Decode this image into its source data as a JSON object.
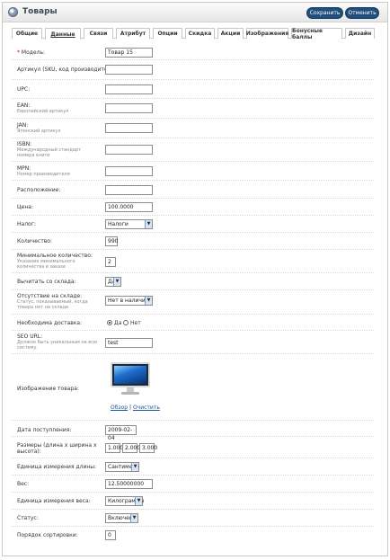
{
  "header": {
    "title": "Товары",
    "save_label": "Сохранить",
    "cancel_label": "Отменить"
  },
  "tabs": [
    {
      "label": "Общие"
    },
    {
      "label": "Данные"
    },
    {
      "label": "Связи"
    },
    {
      "label": "Атрибут"
    },
    {
      "label": "Опции"
    },
    {
      "label": "Скидка"
    },
    {
      "label": "Акции"
    },
    {
      "label": "Изображения"
    },
    {
      "label": "Бонусные баллы"
    },
    {
      "label": "Дизайн"
    }
  ],
  "active_tab": "Данные",
  "form": {
    "model": {
      "required_mark": "*",
      "label": "Модель:",
      "value": "Товар 15"
    },
    "sku": {
      "label": "Артикул (SKU, код производителя):",
      "value": ""
    },
    "upc": {
      "label": "UPC:",
      "value": ""
    },
    "ean": {
      "label": "EAN:",
      "hint": "Европейский артикул",
      "value": ""
    },
    "jan": {
      "label": "JAN:",
      "hint": "Японский артикул",
      "value": ""
    },
    "isbn": {
      "label": "ISBN:",
      "hint": "Международный стандарт номера книги",
      "value": ""
    },
    "mpn": {
      "label": "MPN:",
      "hint": "Номер производителя",
      "value": ""
    },
    "location": {
      "label": "Расположение:",
      "value": ""
    },
    "price": {
      "label": "Цена:",
      "value": "100.0000"
    },
    "tax": {
      "label": "Налог:",
      "value": "Налоги"
    },
    "quantity": {
      "label": "Количество:",
      "value": "990"
    },
    "minimum": {
      "label": "Минимальное количество:",
      "hint": "Указание минимального количества в заказе",
      "value": "2"
    },
    "subtract": {
      "label": "Вычитать со склада:",
      "value": "Да"
    },
    "stock_status": {
      "label": "Отсутствие на складе:",
      "hint": "Статус, показываемый, когда товара нет на складе",
      "value": "Нет в наличии"
    },
    "shipping": {
      "label": "Необходима доставка:",
      "yes_label": "Да",
      "no_label": "Нет",
      "selected": "yes"
    },
    "seo": {
      "label": "SEO URL:",
      "hint": "Должно быть уникальным на всю систему.",
      "value": "test"
    },
    "image": {
      "label": "Изображение товара:",
      "browse_label": "Обзор",
      "separator": "|",
      "clear_label": "Очистить"
    },
    "date_available": {
      "label": "Дата поступления:",
      "value": "2009-02-04"
    },
    "dimensions": {
      "label": "Размеры (длина x ширина x высота):",
      "length": "1.000",
      "width": "2.000",
      "height": "3.000"
    },
    "length_class": {
      "label": "Единица измерения длины:",
      "value": "Сантиметр"
    },
    "weight": {
      "label": "Вес:",
      "value": "12.50000000"
    },
    "weight_class": {
      "label": "Единица измерения веса:",
      "value": "Килограммы"
    },
    "status": {
      "label": "Статус:",
      "value": "Включено"
    },
    "sort_order": {
      "label": "Порядок сортировки:",
      "value": "0"
    }
  }
}
